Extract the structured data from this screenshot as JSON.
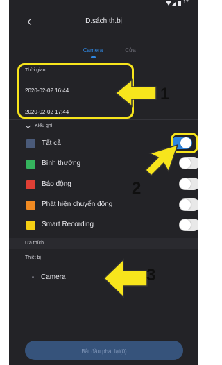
{
  "status_bar": {
    "time": "17:"
  },
  "header": {
    "title": "D.sách th.bị"
  },
  "tabs": [
    {
      "label": "Camera",
      "active": true
    },
    {
      "label": "Cửa",
      "active": false
    }
  ],
  "time_section": {
    "label": "Thời gian",
    "start": "2020-02-02 16:44",
    "end": "2020-02-02 17:44"
  },
  "record_type": {
    "label": "Kiểu ghi",
    "items": [
      {
        "label": "Tất cả",
        "color": "#4a5a79",
        "enabled": true
      },
      {
        "label": "Bình thường",
        "color": "#35b35d",
        "enabled": false
      },
      {
        "label": "Báo động",
        "color": "#df3f35",
        "enabled": false
      },
      {
        "label": "Phát hiện chuyển động",
        "color": "#f08a22",
        "enabled": false
      },
      {
        "label": "Smart Recording",
        "color": "#f5cf14",
        "enabled": false
      }
    ]
  },
  "favorites": {
    "label": "Ưa thích"
  },
  "devices": {
    "label": "Thiết bị",
    "item": "Camera"
  },
  "footer": {
    "button_label": "Bắt đầu phát lại(0)"
  },
  "annotations": {
    "n1": "1",
    "n2": "2",
    "n3": "3",
    "accent": "#f7e51c"
  }
}
